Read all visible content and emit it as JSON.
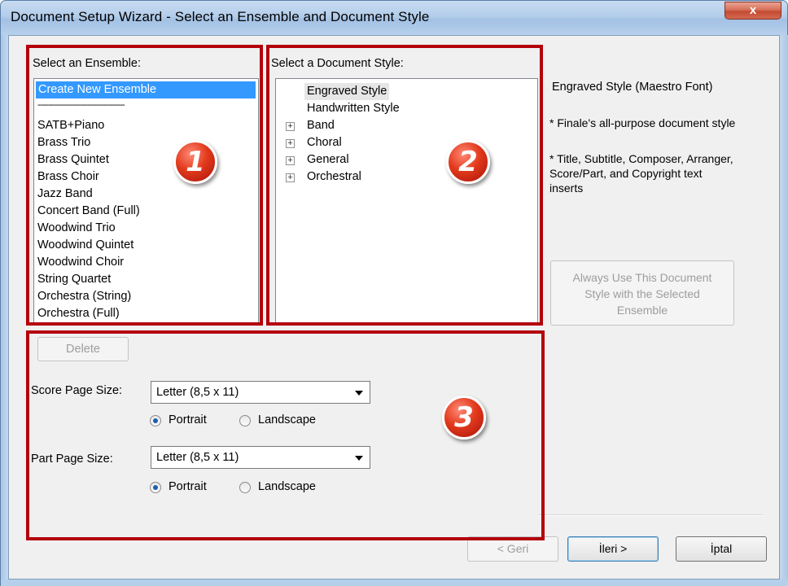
{
  "window": {
    "title": "Document Setup Wizard - Select an Ensemble and Document Style",
    "close_label": "x"
  },
  "ensemble": {
    "label": "Select an Ensemble:",
    "items": [
      "Create New Ensemble",
      "----------------------------------------",
      "SATB+Piano",
      "Brass Trio",
      "Brass Quintet",
      "Brass Choir",
      "Jazz Band",
      "Concert Band (Full)",
      "Woodwind Trio",
      "Woodwind Quintet",
      "Woodwind Choir",
      "String Quartet",
      "Orchestra (String)",
      "Orchestra (Full)"
    ],
    "selected": "Create New Ensemble"
  },
  "style": {
    "label": "Select a Document Style:",
    "items": [
      "Engraved Style",
      "Handwritten Style",
      "Band",
      "Choral",
      "General",
      "Orchestral"
    ],
    "expander_symbol": "+"
  },
  "description": {
    "title": "Engraved Style (Maestro Font)",
    "line1": "* Finale's all-purpose document style",
    "line2_a": "* Title, Subtitle, Composer, Arranger,",
    "line2_b": "Score/Part, and Copyright text",
    "line2_c": "inserts"
  },
  "always_use_button": {
    "line1": "Always Use This Document",
    "line2": "Style with the Selected",
    "line3": "Ensemble"
  },
  "delete_button": "Delete",
  "score": {
    "label": "Score Page Size:",
    "value": "Letter (8,5 x 11)",
    "portrait": "Portrait",
    "landscape": "Landscape"
  },
  "part": {
    "label": "Part Page Size:",
    "value": "Letter (8,5 x 11)",
    "portrait": "Portrait",
    "landscape": "Landscape"
  },
  "nav": {
    "back": "< Geri",
    "next": "İleri >",
    "cancel": "İptal"
  },
  "annotations": {
    "badge1": "1",
    "badge2": "2",
    "badge3": "3",
    "color": "#b3000c"
  }
}
